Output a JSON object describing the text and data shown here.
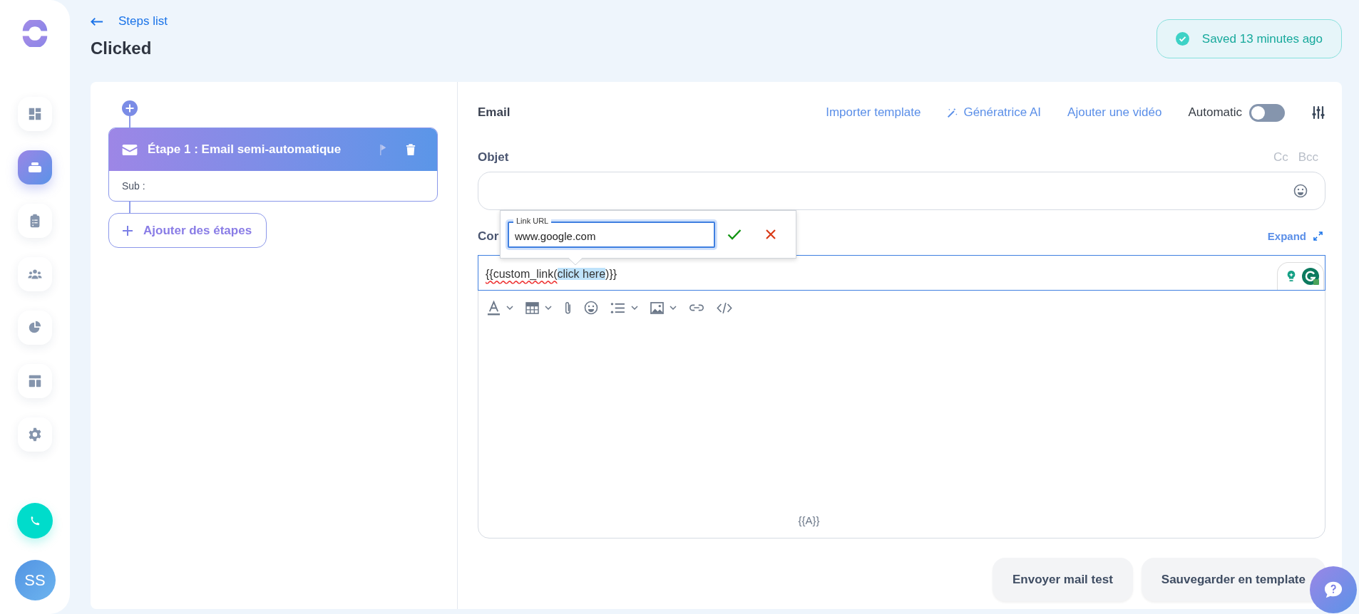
{
  "sidebar": {
    "nav_items": [
      {
        "kind": "dashboard",
        "selected": false
      },
      {
        "kind": "sequences",
        "selected": true
      },
      {
        "kind": "tasks",
        "selected": false
      },
      {
        "kind": "contacts",
        "selected": false
      },
      {
        "kind": "reports",
        "selected": false
      },
      {
        "kind": "templates",
        "selected": false
      },
      {
        "kind": "settings",
        "selected": false
      }
    ],
    "avatar": {
      "initials": "SS"
    }
  },
  "header": {
    "back_link": "Steps list",
    "title": "Clicked",
    "save_status": "Saved 13 minutes ago"
  },
  "steps": [
    {
      "title": "Étape 1 : Email semi-automatique",
      "subject_label": "Sub :"
    }
  ],
  "add_step_button": "Ajouter des étapes",
  "editor": {
    "heading": "Email",
    "actions": [
      {
        "label": "Importer template",
        "has_icon": false
      },
      {
        "label": "Génératrice AI",
        "has_icon": true
      },
      {
        "label": "Ajouter une vidéo",
        "has_icon": false
      }
    ],
    "automatic": {
      "label": "Automatic",
      "on": false
    },
    "subject": {
      "label": "Objet",
      "cc": "Cc",
      "bcc": "Bcc"
    },
    "body": {
      "label": "Cor",
      "expand": "Expand",
      "content_before": "{{custom_link(",
      "selected_text": "click here",
      "content_after": ")}}",
      "footer_tag": "{{A}}"
    },
    "link_popup": {
      "label": "Link URL",
      "value": "www.google.com"
    }
  },
  "buttons": [
    "Envoyer mail test",
    "Sauvegarder en template"
  ]
}
